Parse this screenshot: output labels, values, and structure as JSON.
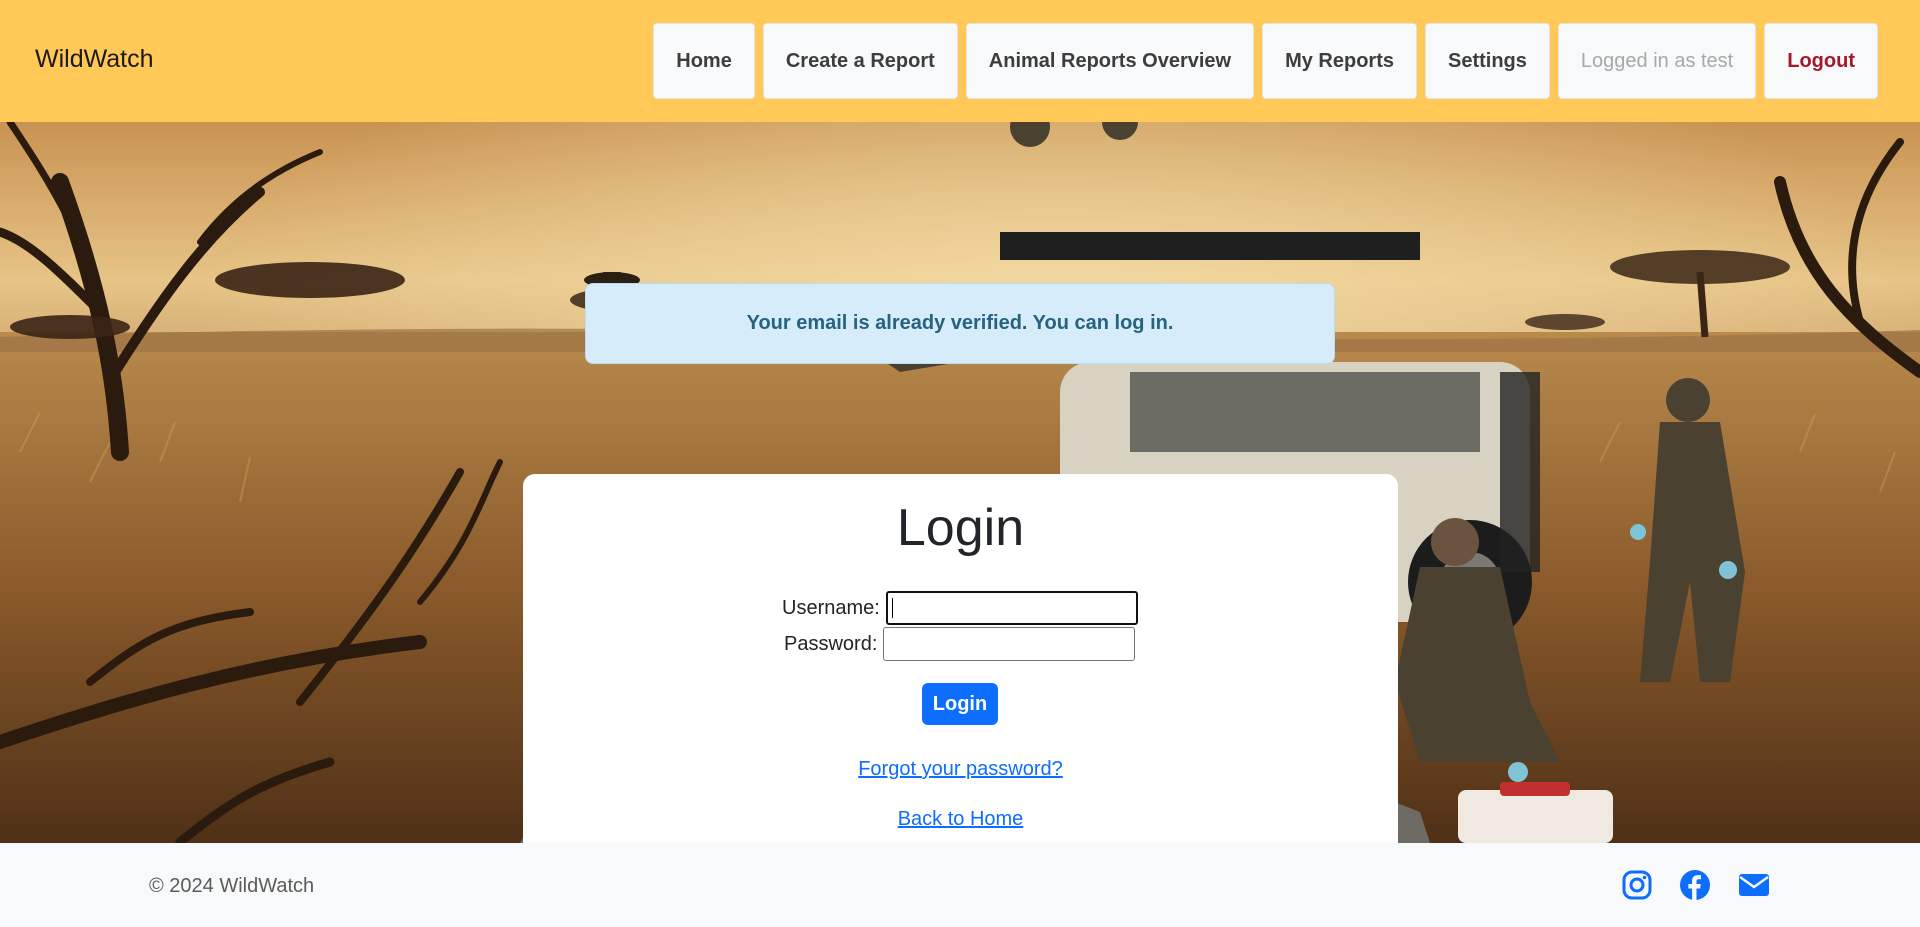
{
  "brand": "WildWatch",
  "nav": {
    "home": "Home",
    "create_report": "Create a Report",
    "overview": "Animal Reports Overview",
    "my_reports": "My Reports",
    "settings": "Settings",
    "status": "Logged in as test",
    "logout": "Logout"
  },
  "alert": "Your email is already verified. You can log in.",
  "login": {
    "title": "Login",
    "username_label": "Username:",
    "password_label": "Password:",
    "username_value": "",
    "password_value": "",
    "submit": "Login",
    "forgot_link": "Forgot your password?",
    "home_link": "Back to Home"
  },
  "footer": {
    "copyright": "© 2024 WildWatch",
    "icons": [
      "instagram-icon",
      "facebook-icon",
      "envelope-icon"
    ]
  },
  "colors": {
    "header": "#ffc857",
    "primary": "#0d6efd",
    "logout": "#a3182b",
    "alert_bg": "#d7ecfa",
    "alert_text": "#27627f"
  }
}
